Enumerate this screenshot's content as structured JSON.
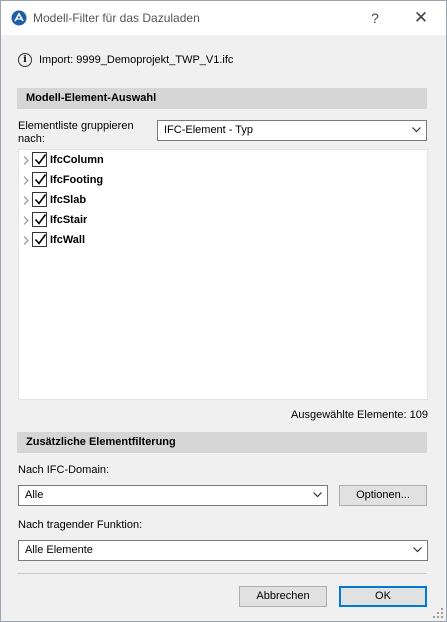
{
  "window": {
    "title": "Modell-Filter für das Dazuladen",
    "help_label": "?",
    "close_label": "✕"
  },
  "import_info": {
    "icon": "info-icon",
    "text": "Import: 9999_Demoprojekt_TWP_V1.ifc"
  },
  "model_selection": {
    "header": "Modell-Element-Auswahl",
    "group_label": "Elementliste gruppieren nach:",
    "group_value": "IFC-Element - Typ",
    "items": [
      {
        "label": "IfcColumn",
        "checked": true
      },
      {
        "label": "IfcFooting",
        "checked": true
      },
      {
        "label": "IfcSlab",
        "checked": true
      },
      {
        "label": "IfcStair",
        "checked": true
      },
      {
        "label": "IfcWall",
        "checked": true
      }
    ],
    "selected_count_text": "Ausgewählte Elemente: 109"
  },
  "additional_filter": {
    "header": "Zusätzliche Elementfilterung",
    "domain_label": "Nach IFC-Domain:",
    "domain_value": "Alle",
    "options_button": "Optionen...",
    "function_label": "Nach tragender Funktion:",
    "function_value": "Alle Elemente"
  },
  "footer": {
    "cancel_label": "Abbrechen",
    "ok_label": "OK"
  },
  "colors": {
    "accent": "#0078d7",
    "section_bg": "#d6d6d6",
    "dialog_bg": "#f0f0f0"
  }
}
